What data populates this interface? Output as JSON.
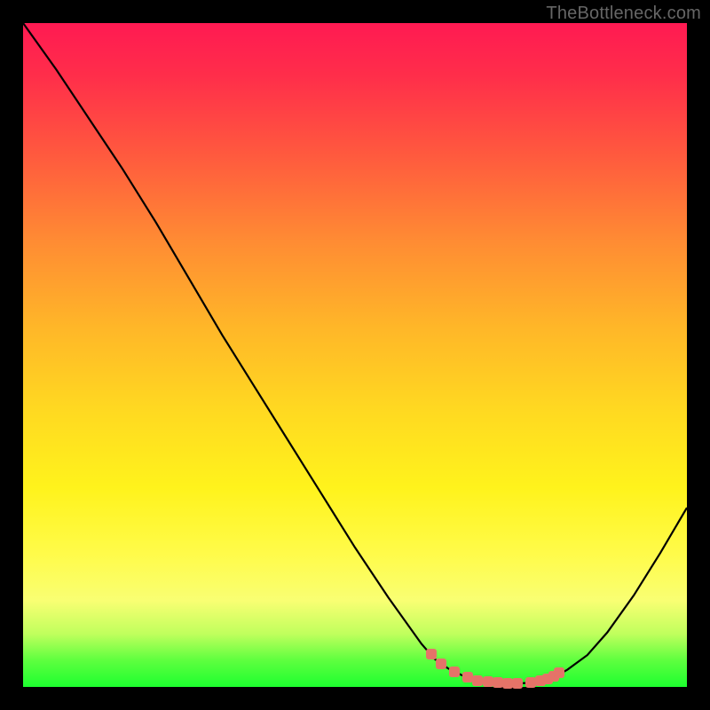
{
  "watermark": "TheBottleneck.com",
  "chart_data": {
    "type": "line",
    "title": "",
    "xlabel": "",
    "ylabel": "",
    "xlim": [
      0,
      100
    ],
    "ylim": [
      0,
      100
    ],
    "series": [
      {
        "name": "curve",
        "x": [
          0,
          5,
          10,
          15,
          20,
          25,
          30,
          35,
          40,
          45,
          50,
          55,
          60,
          62,
          64,
          66,
          68,
          70,
          72,
          74,
          76,
          78,
          80,
          82,
          85,
          88,
          92,
          96,
          100
        ],
        "y": [
          100,
          93,
          85.5,
          78,
          70,
          61.5,
          53,
          45,
          37,
          29,
          21,
          13.5,
          6.5,
          4.2,
          2.8,
          1.8,
          1.1,
          0.7,
          0.5,
          0.5,
          0.6,
          0.9,
          1.5,
          2.6,
          4.8,
          8.2,
          13.8,
          20.2,
          27.0
        ]
      }
    ],
    "markers": {
      "name": "highlighted-points",
      "x": [
        61.5,
        63.0,
        65.0,
        67.0,
        68.5,
        70.0,
        71.5,
        73.0,
        74.5,
        76.5,
        78.0,
        79.0,
        80.0,
        80.8
      ],
      "y": [
        5.0,
        3.5,
        2.3,
        1.5,
        1.0,
        0.8,
        0.7,
        0.6,
        0.6,
        0.7,
        0.9,
        1.2,
        1.6,
        2.1
      ]
    },
    "gradient_stops": [
      {
        "pos": 0,
        "color": "#ff1a52"
      },
      {
        "pos": 50,
        "color": "#ffb728"
      },
      {
        "pos": 80,
        "color": "#fffb4a"
      },
      {
        "pos": 100,
        "color": "#1dff2f"
      }
    ]
  }
}
